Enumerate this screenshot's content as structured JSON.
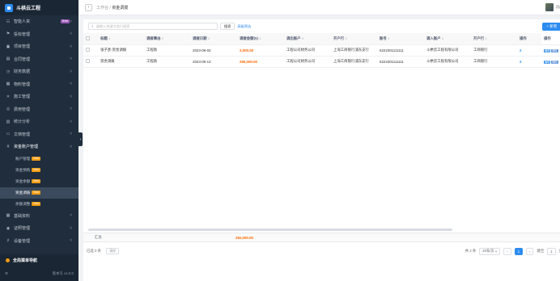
{
  "app": {
    "title": "斗栱云工程"
  },
  "sidebar": {
    "items": [
      {
        "label": "智能人资",
        "icon": "people-icon",
        "badge": "Beta"
      },
      {
        "label": "投标管理",
        "icon": "bid-icon"
      },
      {
        "label": "项目管理",
        "icon": "project-icon"
      },
      {
        "label": "合同管理",
        "icon": "contract-icon"
      },
      {
        "label": "财务数据",
        "icon": "finance-icon"
      },
      {
        "label": "物料管理",
        "icon": "material-icon"
      },
      {
        "label": "施工管理",
        "icon": "construction-icon"
      },
      {
        "label": "费用管理",
        "icon": "cost-icon"
      },
      {
        "label": "统计分析",
        "icon": "chart-icon"
      },
      {
        "label": "文档管理",
        "icon": "doc-icon"
      }
    ],
    "expanded": {
      "label": "资金账户管理",
      "icon": "account-icon"
    },
    "subitems": [
      {
        "label": "账户管理",
        "tag": "New"
      },
      {
        "label": "资金预购",
        "tag": "New"
      },
      {
        "label": "资金余额",
        "tag": "New"
      },
      {
        "label": "资金调拨",
        "tag": "New"
      },
      {
        "label": "余额调整",
        "tag": "New"
      }
    ],
    "after_items": [
      {
        "label": "基础资料",
        "icon": "base-icon"
      },
      {
        "label": "证照管理",
        "icon": "license-icon"
      },
      {
        "label": "设备管理",
        "icon": "device-icon"
      }
    ],
    "nav_guide": "全局菜单导航",
    "version": "版本号 v4.0.0"
  },
  "topbar": {
    "breadcrumb_parent": "工作台",
    "breadcrumb_current": "资金调拨",
    "user_name": "用户"
  },
  "toolbar": {
    "search_placeholder": "请输入关键字进行搜索",
    "search_label": "搜索",
    "clear_label": "高级筛选",
    "add_label": "+ 新增"
  },
  "table": {
    "headers": [
      "标题",
      "调拨事由",
      "调拨日期",
      "调拨金额(¥)",
      "调出账户",
      "开户行",
      "账号",
      "调入账户",
      "开户行",
      "操作"
    ],
    "rows": [
      [
        "张子彦-资金调拨",
        "工程款",
        "2023-09-03",
        "2,000.00",
        "工程公司财务公司",
        "上海工商银行浦东支行",
        "6222301111111",
        "斗栱云工程有限公司",
        "工商银行",
        "2"
      ],
      [
        "资金调拨",
        "工程款",
        "2023-09-13",
        "250,000.00",
        "工程公司财务公司",
        "上海工商银行浦东支行",
        "6222301111111",
        "斗栱云工程有限公司",
        "工商银行",
        "2"
      ]
    ],
    "ops_label": "操作"
  },
  "summary": {
    "label": "汇总",
    "total": "252,000.00"
  },
  "pager": {
    "selected_text": "已选 0 条",
    "clear_text": "清除",
    "total_text": "共 2 条",
    "page_size": "20条/页",
    "current_page": "1",
    "goto_label": "跳至",
    "goto_value": "1",
    "page_unit": "页"
  },
  "colors": {
    "sidebar_bg": "#1f2d3d",
    "accent": "#2d8cf0",
    "amount": "#ff6a00"
  }
}
